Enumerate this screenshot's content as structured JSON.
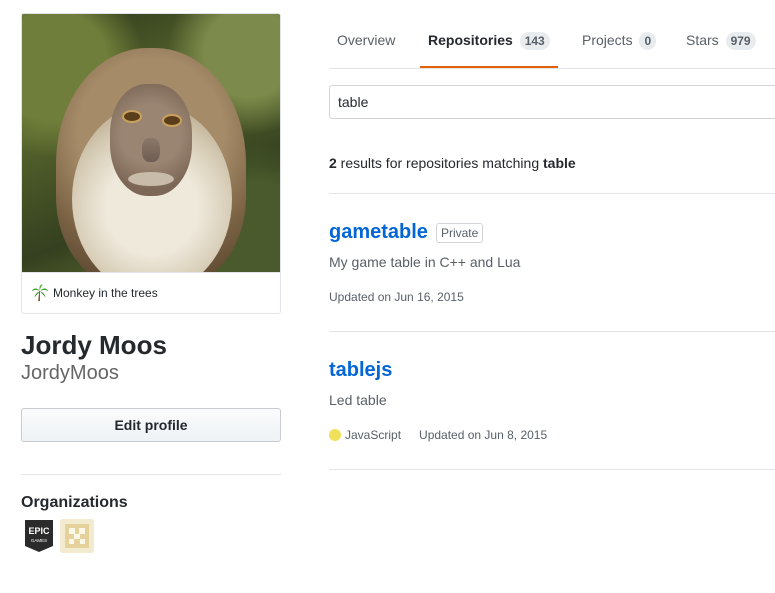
{
  "profile": {
    "status_text": "Monkey in the trees",
    "status_emoji": "palm-tree-icon",
    "fullname": "Jordy Moos",
    "username": "JordyMoos",
    "edit_label": "Edit profile",
    "organizations_title": "Organizations",
    "organizations": [
      {
        "name": "epic-games-logo",
        "text": "EPIC\nGAMES"
      },
      {
        "name": "pixel-skull-logo"
      }
    ]
  },
  "tabs": [
    {
      "label": "Overview",
      "count": null,
      "selected": false
    },
    {
      "label": "Repositories",
      "count": "143",
      "selected": true
    },
    {
      "label": "Projects",
      "count": "0",
      "selected": false
    },
    {
      "label": "Stars",
      "count": "979",
      "selected": false
    }
  ],
  "search": {
    "value": "table"
  },
  "results": {
    "count": "2",
    "text": " results for repositories matching ",
    "query": "table"
  },
  "repos": [
    {
      "name": "gametable",
      "badge": "Private",
      "description": "My game table in C++ and Lua",
      "language": null,
      "updated": "Updated on Jun 16, 2015"
    },
    {
      "name": "tablejs",
      "badge": null,
      "description": "Led table",
      "language": "JavaScript",
      "language_color": "#f1e05a",
      "updated": "Updated on Jun 8, 2015"
    }
  ],
  "colors": {
    "accent_tab": "#e36209",
    "link": "#0366d6"
  }
}
